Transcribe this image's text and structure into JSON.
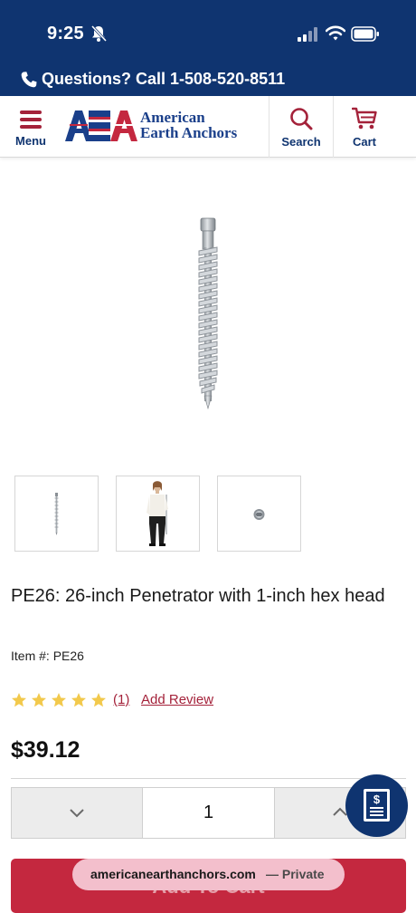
{
  "status_bar": {
    "time": "9:25"
  },
  "call_bar": {
    "text": "Questions? Call 1-508-520-8511"
  },
  "header": {
    "menu_label": "Menu",
    "logo_line1": "American",
    "logo_line2": "Earth Anchors",
    "search_label": "Search",
    "cart_label": "Cart"
  },
  "product": {
    "title": "PE26: 26-inch Penetrator with 1-inch hex head",
    "item_label": "Item #:",
    "item_number": "PE26",
    "rating": 5,
    "review_count": "(1)",
    "add_review": "Add Review",
    "price": "$39.12"
  },
  "quantity": {
    "value": "1"
  },
  "cta": {
    "label": "Add To Cart"
  },
  "browser": {
    "host": "americanearthanchors.com",
    "mode": "— Private"
  },
  "colors": {
    "brand_navy": "#0f3470",
    "accent_red": "#c4283f",
    "link_red": "#a4223a",
    "star": "#f2c94c"
  },
  "icons": [
    "bell-slash-icon",
    "signal-icon",
    "wifi-icon",
    "battery-icon",
    "phone-icon",
    "menu-icon",
    "search-icon",
    "cart-icon",
    "chevron-down-icon",
    "chevron-up-icon",
    "invoice-icon",
    "star-icon"
  ]
}
